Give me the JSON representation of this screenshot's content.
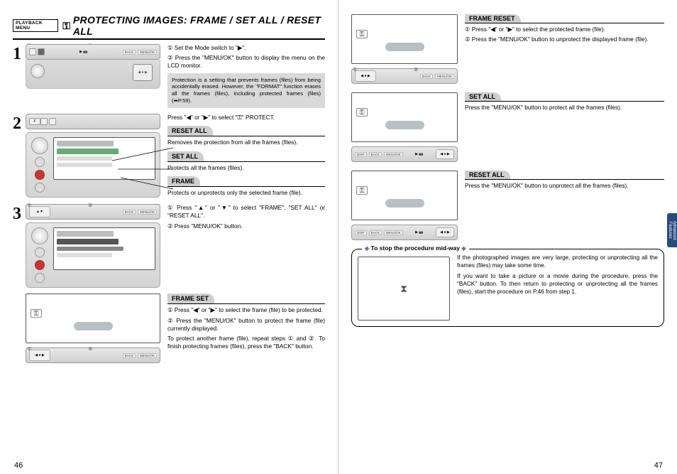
{
  "header": {
    "menu_box": "PLAYBACK MENU",
    "key_icon": "⚿",
    "title": "PROTECTING IMAGES: FRAME / SET ALL / RESET ALL"
  },
  "step1": {
    "num": "1",
    "line1": "① Set the Mode switch to \"▶\".",
    "line2": "② Press the \"MENU/OK\" button to display the menu on the LCD monitor.",
    "note": "Protection is a setting that prevents frames (files) from being accidentally erased. However, the \"FORMAT\" function erases all the frames (files), including protected frames (files) (➡P.59)."
  },
  "step2": {
    "num": "2",
    "intro": "Press \"◀\" or \"▶\" to select \"⚿\" PROTECT.",
    "reset_all": {
      "title": "RESET ALL",
      "body": "Removes the protection from all the frames (files)."
    },
    "set_all": {
      "title": "SET ALL",
      "body": "Protects all the frames (files)."
    },
    "frame": {
      "title": "FRAME",
      "body": "Protects or unprotects only the selected frame (file)."
    }
  },
  "step3": {
    "num": "3",
    "line1": "① Press \"▲\" or \"▼\" to select \"FRAME\", \"SET ALL\" or \"RESET ALL\".",
    "line2": "② Press \"MENU/OK\" button."
  },
  "frame_set": {
    "title": "FRAME SET",
    "line1": "① Press \"◀\" or \"▶\" to select the frame (file) to be protected.",
    "line2": "② Press the \"MENU/OK\" button to protect the frame (file) currently displayed.",
    "cont": "To protect another frame (file), repeat steps ① and ②. To finish protecting frames (files), press the \"BACK\" button."
  },
  "frame_reset": {
    "title": "FRAME RESET",
    "line1": "① Press \"◀\" or \"▶\" to select the protected frame (file).",
    "line2": "② Press the \"MENU/OK\" button to unprotect the displayed frame (file)."
  },
  "set_all_r": {
    "title": "SET ALL",
    "body": "Press the \"MENU/OK\" button to protect all the frames (files)."
  },
  "reset_all_r": {
    "title": "RESET ALL",
    "body": "Press the \"MENU/OK\" button to unprotect all the frames (files)."
  },
  "midway": {
    "title": "To stop the procedure mid-way",
    "p1": "If the photographed images are very large, protecting or unprotecting all the frames (files) may take some time.",
    "p2": "If you want to take a picture or a movie during the procedure, press the \"BACK\" button. To then return to protecting or unprotecting all the frames (files), start the procedure on P.46 from step 1."
  },
  "side_tab": "Advanced Features",
  "page_left": "46",
  "page_right": "47",
  "labels": {
    "disp": "DISP",
    "back": "BACK",
    "menuok": "MENU/OK",
    "f": "F"
  }
}
